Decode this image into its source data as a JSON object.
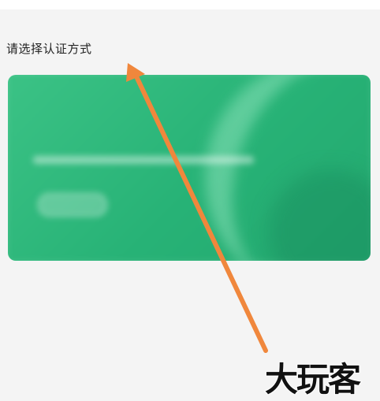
{
  "header": {
    "prompt": "请选择认证方式"
  },
  "card": {
    "title": "",
    "accent_color": "#27b276"
  },
  "annotation": {
    "arrow_color": "#f0873c",
    "watermark": "大玩客"
  }
}
